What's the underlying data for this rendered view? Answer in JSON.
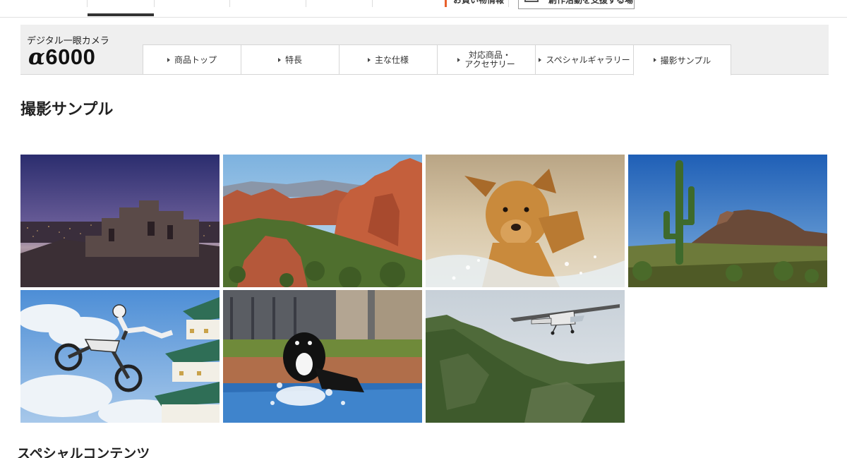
{
  "topnav": {
    "item_shopping": "お買い物情報",
    "item_creative": "創作活動を支援する場"
  },
  "product": {
    "category": "デジタル一眼カメラ",
    "model_alpha": "α",
    "model_number": "6000"
  },
  "tabs": [
    {
      "label": "商品トップ"
    },
    {
      "label": "特長"
    },
    {
      "label": "主な仕様"
    },
    {
      "label_line1": "対応商品・",
      "label_line2": "アクセサリー"
    },
    {
      "label": "スペシャルギャラリー"
    },
    {
      "label": "撮影サンプル"
    }
  ],
  "page_title": "撮影サンプル",
  "gallery": {
    "items": [
      {
        "icon": "night-ruins-cityscape-photo"
      },
      {
        "icon": "red-rock-canyon-photo"
      },
      {
        "icon": "running-golden-retriever-photo"
      },
      {
        "icon": "saguaro-cactus-desert-photo"
      },
      {
        "icon": "motocross-jump-castle-photo"
      },
      {
        "icon": "dog-jumping-pool-photo"
      },
      {
        "icon": "small-plane-over-mountain-photo"
      }
    ]
  },
  "special_section_title": "スペシャルコンテンツ"
}
